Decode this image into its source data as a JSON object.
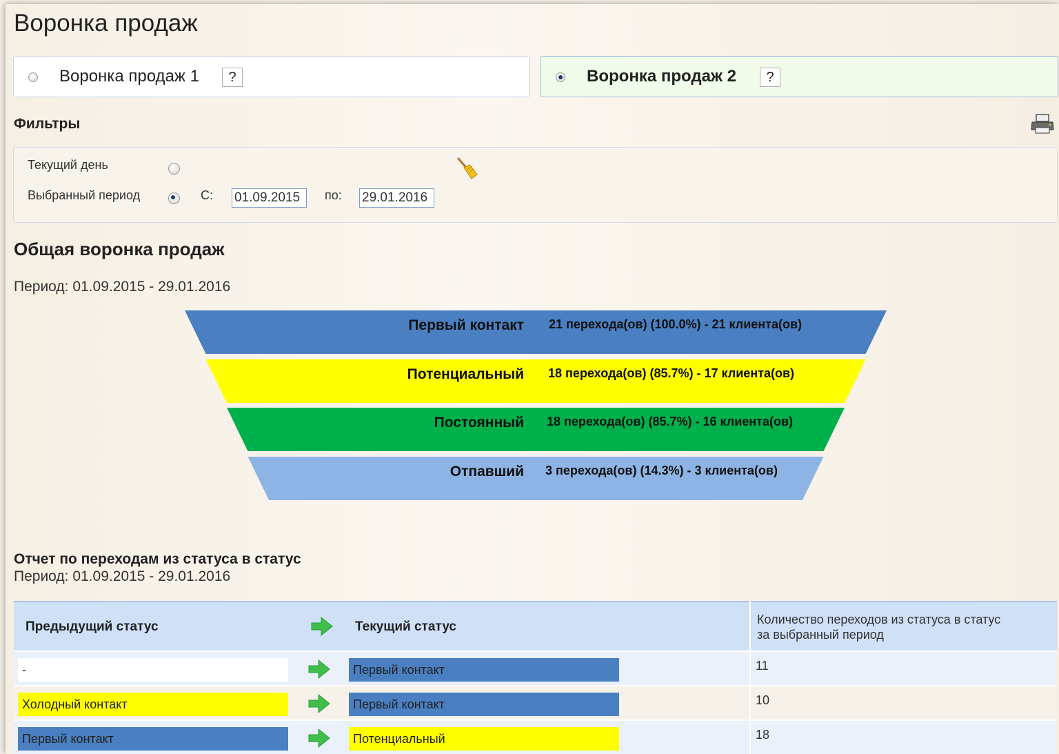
{
  "page_title": "Воронка продаж",
  "funnel_tabs": [
    {
      "label": "Воронка продаж 1",
      "help": "?",
      "selected": false
    },
    {
      "label": "Воронка продаж 2",
      "help": "?",
      "selected": true
    }
  ],
  "filters": {
    "heading": "Фильтры",
    "current_day_label": "Текущий день",
    "selected_period_label": "Выбранный период",
    "from_label": "С:",
    "from_value": "01.09.2015",
    "to_label": "по:",
    "to_value": "29.01.2016",
    "period_mode": "selected"
  },
  "overall": {
    "title": "Общая воронка продаж",
    "period": "Период: 01.09.2015 - 29.01.2016"
  },
  "chart_data": {
    "type": "funnel",
    "stages": [
      {
        "name": "Первый контакт",
        "transitions": 21,
        "percent": 100.0,
        "clients": 21,
        "label": "21 перехода(ов) (100.0%) - 21 клиента(ов)",
        "color": "#4a7fc1"
      },
      {
        "name": "Потенциальный",
        "transitions": 18,
        "percent": 85.7,
        "clients": 17,
        "label": "18 перехода(ов) (85.7%) - 17 клиента(ов)",
        "color": "#ffff00"
      },
      {
        "name": "Постоянный",
        "transitions": 18,
        "percent": 85.7,
        "clients": 16,
        "label": "18 перехода(ов) (85.7%) - 16 клиента(ов)",
        "color": "#00b04a"
      },
      {
        "name": "Отпавший",
        "transitions": 3,
        "percent": 14.3,
        "clients": 3,
        "label": "3 перехода(ов) (14.3%) - 3 клиента(ов)",
        "color": "#8db4e4"
      }
    ]
  },
  "report": {
    "title": "Отчет по переходам из статуса в статус",
    "period": "Период: 01.09.2015 - 29.01.2016",
    "headers": {
      "previous": "Предыдущий статус",
      "current": "Текущий статус",
      "count_line1": "Количество переходов из статуса в статус",
      "count_line2": "за выбранный период"
    },
    "rows": [
      {
        "prev": "-",
        "prev_color": "#ffffff",
        "curr": "Первый контакт",
        "curr_color": "#4a7fc1",
        "count": "11"
      },
      {
        "prev": "Холодный контакт",
        "prev_color": "#ffff00",
        "curr": "Первый контакт",
        "curr_color": "#4a7fc1",
        "count": "10"
      },
      {
        "prev": "Первый контакт",
        "prev_color": "#4a7fc1",
        "curr": "Потенциальный",
        "curr_color": "#ffff00",
        "count": "18"
      }
    ]
  }
}
